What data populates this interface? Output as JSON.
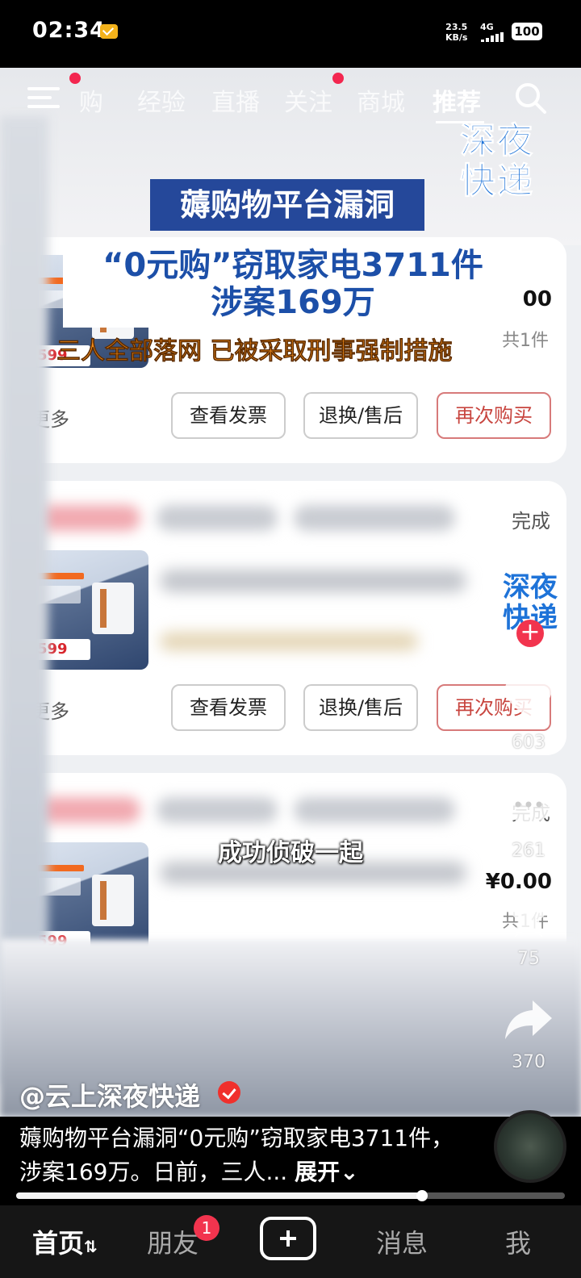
{
  "status_bar": {
    "time": "02:34",
    "net_speed_value": "23.5",
    "net_speed_unit": "KB/s",
    "network": "4G",
    "battery": "100"
  },
  "top_nav": {
    "tabs": [
      "购",
      "经验",
      "直播",
      "关注",
      "商城",
      "推荐"
    ],
    "active_tab": "推荐"
  },
  "logo": {
    "line1": "深夜",
    "line2": "快递"
  },
  "headline": {
    "tag": "薅购物平台漏洞",
    "line1": "“0元购”窃取家电3711件",
    "line2": "涉案169万",
    "sub": "三人全部落网 已被采取刑事强制措施"
  },
  "orders": [
    {
      "status": "",
      "price": "¥0.00",
      "count": "共1件",
      "more": "更多",
      "btn_invoice": "查看发票",
      "btn_return": "退换/售后",
      "btn_rebuy": "再次购买",
      "product_price_tag": "599"
    },
    {
      "status": "完成",
      "price": "",
      "count": "",
      "more": "更多",
      "btn_invoice": "查看发票",
      "btn_return": "退换/售后",
      "btn_rebuy": "再次购买",
      "product_price_tag": "599"
    },
    {
      "status": "完成",
      "price": "¥0.00",
      "count": "共1件",
      "more": "",
      "btn_invoice": "",
      "btn_return": "",
      "btn_rebuy": "",
      "product_price_tag": "599"
    }
  ],
  "caption": "成功侦破一起",
  "right_rail": {
    "avatar_line1": "深夜",
    "avatar_line2": "快递",
    "likes": "603",
    "comments": "261",
    "favorites": "75",
    "shares": "370",
    "icons": [
      "heart-icon",
      "comment-icon",
      "star-icon",
      "share-icon"
    ]
  },
  "author": "@云上深夜快递",
  "description": {
    "text": "薅购物平台漏洞“0元购”窃取家电3711件，涉案169万。日前，三人...",
    "expand": "展开"
  },
  "progress": 0.74,
  "tab_bar": {
    "home": "首页",
    "friends": "朋友",
    "friends_badge": "1",
    "messages": "消息",
    "me": "我"
  },
  "colors": {
    "accent_red": "#f2344e",
    "headline_blue": "#25489a",
    "logo_blue": "#1e73d8",
    "subtitle_orange": "#f08a1a"
  }
}
